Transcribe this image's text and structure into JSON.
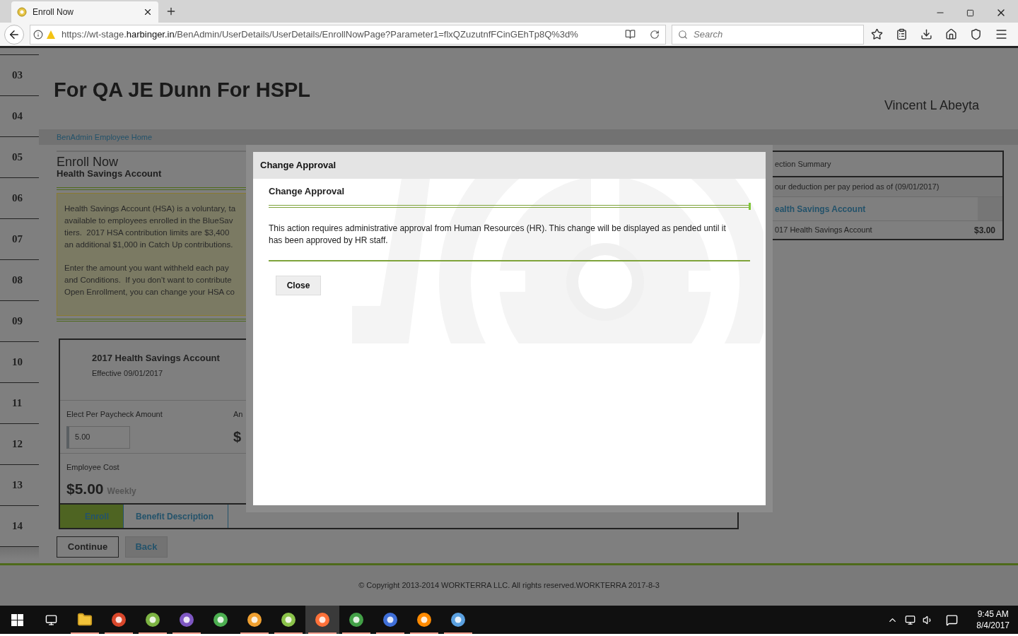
{
  "browser": {
    "tab_title": "Enroll Now",
    "url_prefix": "https://wt-stage.",
    "url_domain": "harbinger.in",
    "url_path": "/BenAdmin/UserDetails/UserDetails/EnrollNowPage?Parameter1=flxQZuzutnfFCinGEhTp8Q%3d%",
    "search_placeholder": "Search"
  },
  "line_numbers": [
    "03",
    "04",
    "05",
    "06",
    "07",
    "08",
    "09",
    "10",
    "11",
    "12",
    "13",
    "14"
  ],
  "page": {
    "title": "For QA JE Dunn For HSPL",
    "user_name": "Vincent L Abeyta",
    "breadcrumb": "BenAdmin Employee Home",
    "heading": "Enroll Now",
    "subheading": "Health Savings Account",
    "intro_paragraphs": [
      [
        "Health Savings Account (HSA) is a voluntary, ta",
        "available to employees enrolled in the BlueSav",
        "tiers.  2017 HSA contribution limits are $3,400",
        "an additional $1,000 in Catch Up contributions."
      ],
      [
        "Enter the amount you want withheld each pay",
        "and Conditions.  If you don’t want to contribute",
        "Open Enrollment, you can change your HSA co"
      ]
    ],
    "card": {
      "title": "2017 Health Savings Account",
      "effective": "Effective 09/01/2017",
      "elect_label": "Elect Per Paycheck Amount",
      "elect_value": "5.00",
      "column_2_label": "An",
      "column_2_value": "$",
      "cost_label": "Employee Cost",
      "cost_value": "$5.00",
      "cost_period": "Weekly",
      "tabs": [
        {
          "label": "Enroll",
          "selected": true
        },
        {
          "label": "Benefit Description",
          "selected": false
        }
      ]
    },
    "buttons": [
      {
        "label": "Continue",
        "kind": "primary"
      },
      {
        "label": "Back",
        "kind": "secondary"
      }
    ],
    "summary": {
      "title": "ection Summary",
      "subtitle": "our deduction per pay period as of (09/01/2017)",
      "section": "ealth Savings Account",
      "item_name": "017 Health Savings Account",
      "item_amount": "$3.00"
    },
    "copyright": "© Copyright 2013-2014 WORKTERRA LLC. All rights reserved.WORKTERRA 2017-8-3"
  },
  "modal": {
    "title": "Change Approval",
    "heading": "Change Approval",
    "message": "This action requires administrative approval from Human Resources (HR). This change will be displayed as pended until it has been approved by HR staff.",
    "close_label": "Close"
  },
  "taskbar": {
    "time": "9:45 AM",
    "date": "8/4/2017"
  }
}
